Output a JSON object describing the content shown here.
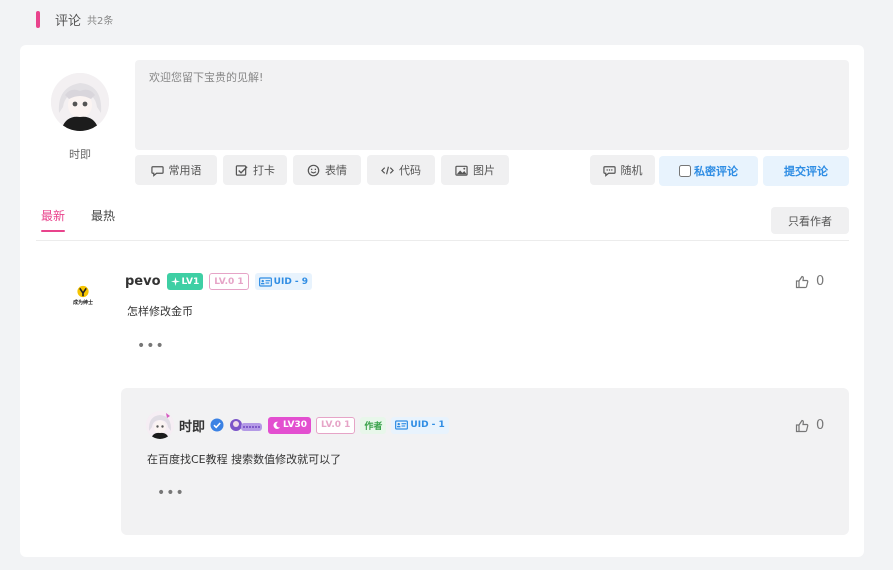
{
  "section": {
    "title": "评论",
    "count": "共2条"
  },
  "composer": {
    "placeholder": "欢迎您留下宝贵的见解!",
    "user_name": "时即",
    "tools": [
      {
        "icon": "speech-bubble-icon",
        "label": "常用语"
      },
      {
        "icon": "checkbox-icon",
        "label": "打卡"
      },
      {
        "icon": "smiley-icon",
        "label": "表情"
      },
      {
        "icon": "code-icon",
        "label": "代码"
      },
      {
        "icon": "image-icon",
        "label": "图片"
      }
    ],
    "random_label": "随机",
    "private_label": "私密评论",
    "submit_label": "提交评论"
  },
  "tabs": {
    "newest": "最新",
    "hottest": "最热",
    "only_author": "只看作者"
  },
  "comments": [
    {
      "username": "pevo",
      "level_badge": "LV1",
      "lv0_badge": "LV.0 1",
      "uid_badge": "UID - 9",
      "avatar_text": "成为绅士",
      "content": "怎样修改金币",
      "likes": "0",
      "more": "•••"
    }
  ],
  "reply": {
    "username": "时即",
    "level_badge": "LV30",
    "lv0_badge": "LV.0 1",
    "author_badge": "作者",
    "uid_badge": "UID - 1",
    "content": "在百度找CE教程 搜索数值修改就可以了",
    "likes": "0",
    "more": "•••"
  },
  "colors": {
    "accent": "#e9438c",
    "blue": "#2f8de4",
    "green_badge": "#3ecfa4",
    "purple_badge": "#e34fd0"
  }
}
